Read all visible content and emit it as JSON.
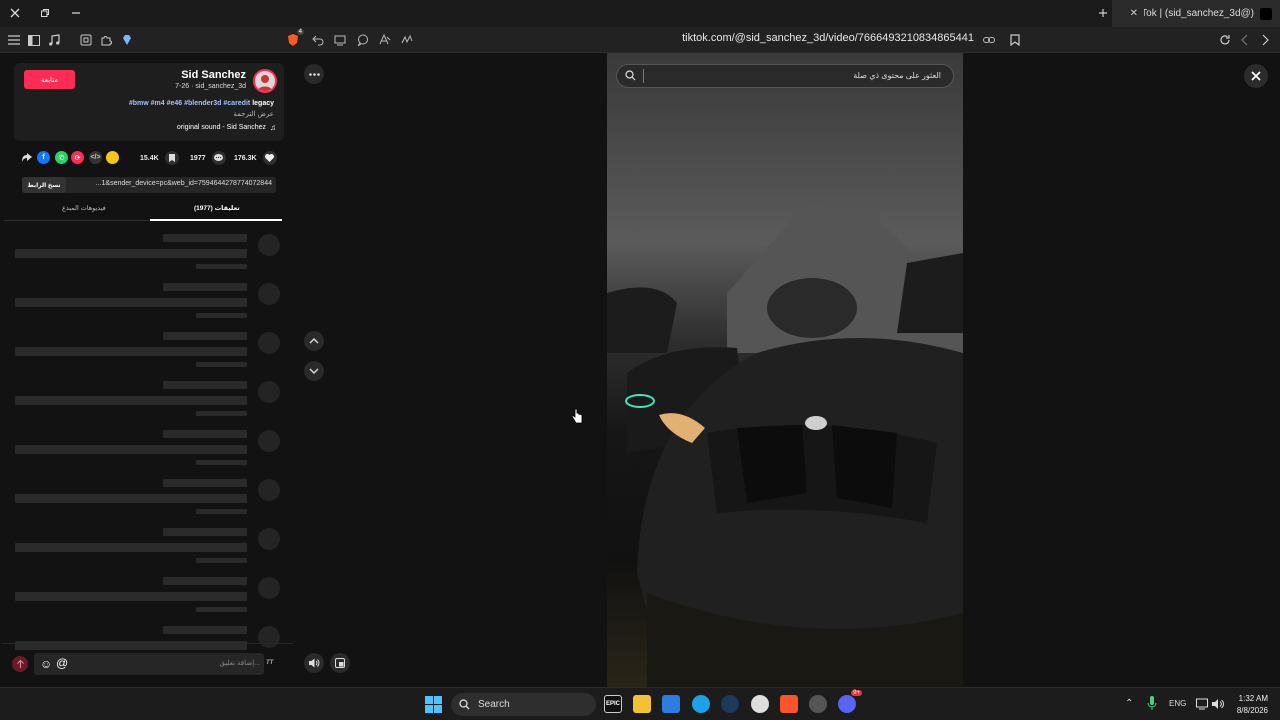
{
  "browser": {
    "tab_title": "(@sid_sanchez_3d) | TikTok ::",
    "url": "tiktok.com/@sid_sanchez_3d/video/7666493210834865441",
    "shield_count": "4"
  },
  "post": {
    "author_name": "Sid Sanchez",
    "author_meta": "7-26 · sid_sanchez_3d",
    "follow_label": "متابعة",
    "caption_plain": "legacy",
    "caption_tags": "#bmw #m4 #e46 #blender3d #caredit",
    "translate_label": "عرض الترجمة",
    "sound": "original sound - Sid Sanchez",
    "likes": "176.3K",
    "comments": "1977",
    "saves": "15.4K",
    "link_text": "...1&sender_device=pc&web_id=7594644278774072844",
    "copy_link_label": "نسخ الرابط"
  },
  "panel_tabs": {
    "comments": "تعليقات (1977)",
    "creator_videos": "فيديوهات المبدع"
  },
  "comment_input": {
    "placeholder": "إضافة تعليق...",
    "at": "@"
  },
  "video": {
    "search_placeholder": "العثور على محتوى ذي صلة"
  },
  "taskbar": {
    "search_label": "Search",
    "lang": "ENG",
    "time": "1:32 AM",
    "date": "8/8/2026",
    "discord_badge": "9+"
  }
}
